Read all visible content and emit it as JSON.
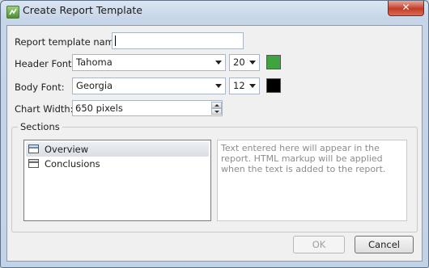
{
  "window": {
    "title": "Create Report Template",
    "close_label": "✕"
  },
  "form": {
    "name_label": "Report template name:",
    "name_value": "",
    "header_font_label": "Header Font:",
    "header_font": "Tahoma",
    "header_size": "20",
    "header_color": "#3fa33f",
    "body_font_label": "Body Font:",
    "body_font": "Georgia",
    "body_size": "12",
    "body_color": "#000000",
    "chart_width_label": "Chart Width:",
    "chart_width": "650 pixels"
  },
  "sections": {
    "label": "Sections",
    "items": [
      {
        "label": "Overview",
        "icon": "section-icon",
        "selected": true
      },
      {
        "label": "Conclusions",
        "icon": "section-icon",
        "selected": false
      }
    ],
    "placeholder": "Text entered here will appear in the report. HTML markup will be applied when the text is added to the report."
  },
  "buttons": {
    "ok": "OK",
    "cancel": "Cancel"
  }
}
